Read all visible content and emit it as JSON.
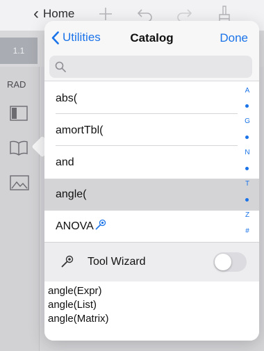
{
  "app": {
    "back_label": "Home",
    "tab_label": "1.1",
    "angle_mode": "RAD"
  },
  "popover": {
    "back_label": "Utilities",
    "title": "Catalog",
    "done_label": "Done",
    "search": {
      "value": "",
      "placeholder": ""
    },
    "items": [
      {
        "label": "abs("
      },
      {
        "label": "amortTbl("
      },
      {
        "label": "and"
      },
      {
        "label": "angle(",
        "selected": true
      },
      {
        "label": "ANOVA",
        "has_wizard": true
      }
    ],
    "index": [
      "A",
      "G",
      "N",
      "T",
      "Z",
      "#"
    ],
    "tool_wizard": {
      "label": "Tool Wizard",
      "enabled": false
    },
    "help_lines": [
      "angle(Expr)",
      "angle(List)",
      "angle(Matrix)"
    ]
  },
  "colors": {
    "accent": "#1a73e8",
    "selected_row": "#d4d4d7",
    "toggle_off": "#dcdce0"
  }
}
